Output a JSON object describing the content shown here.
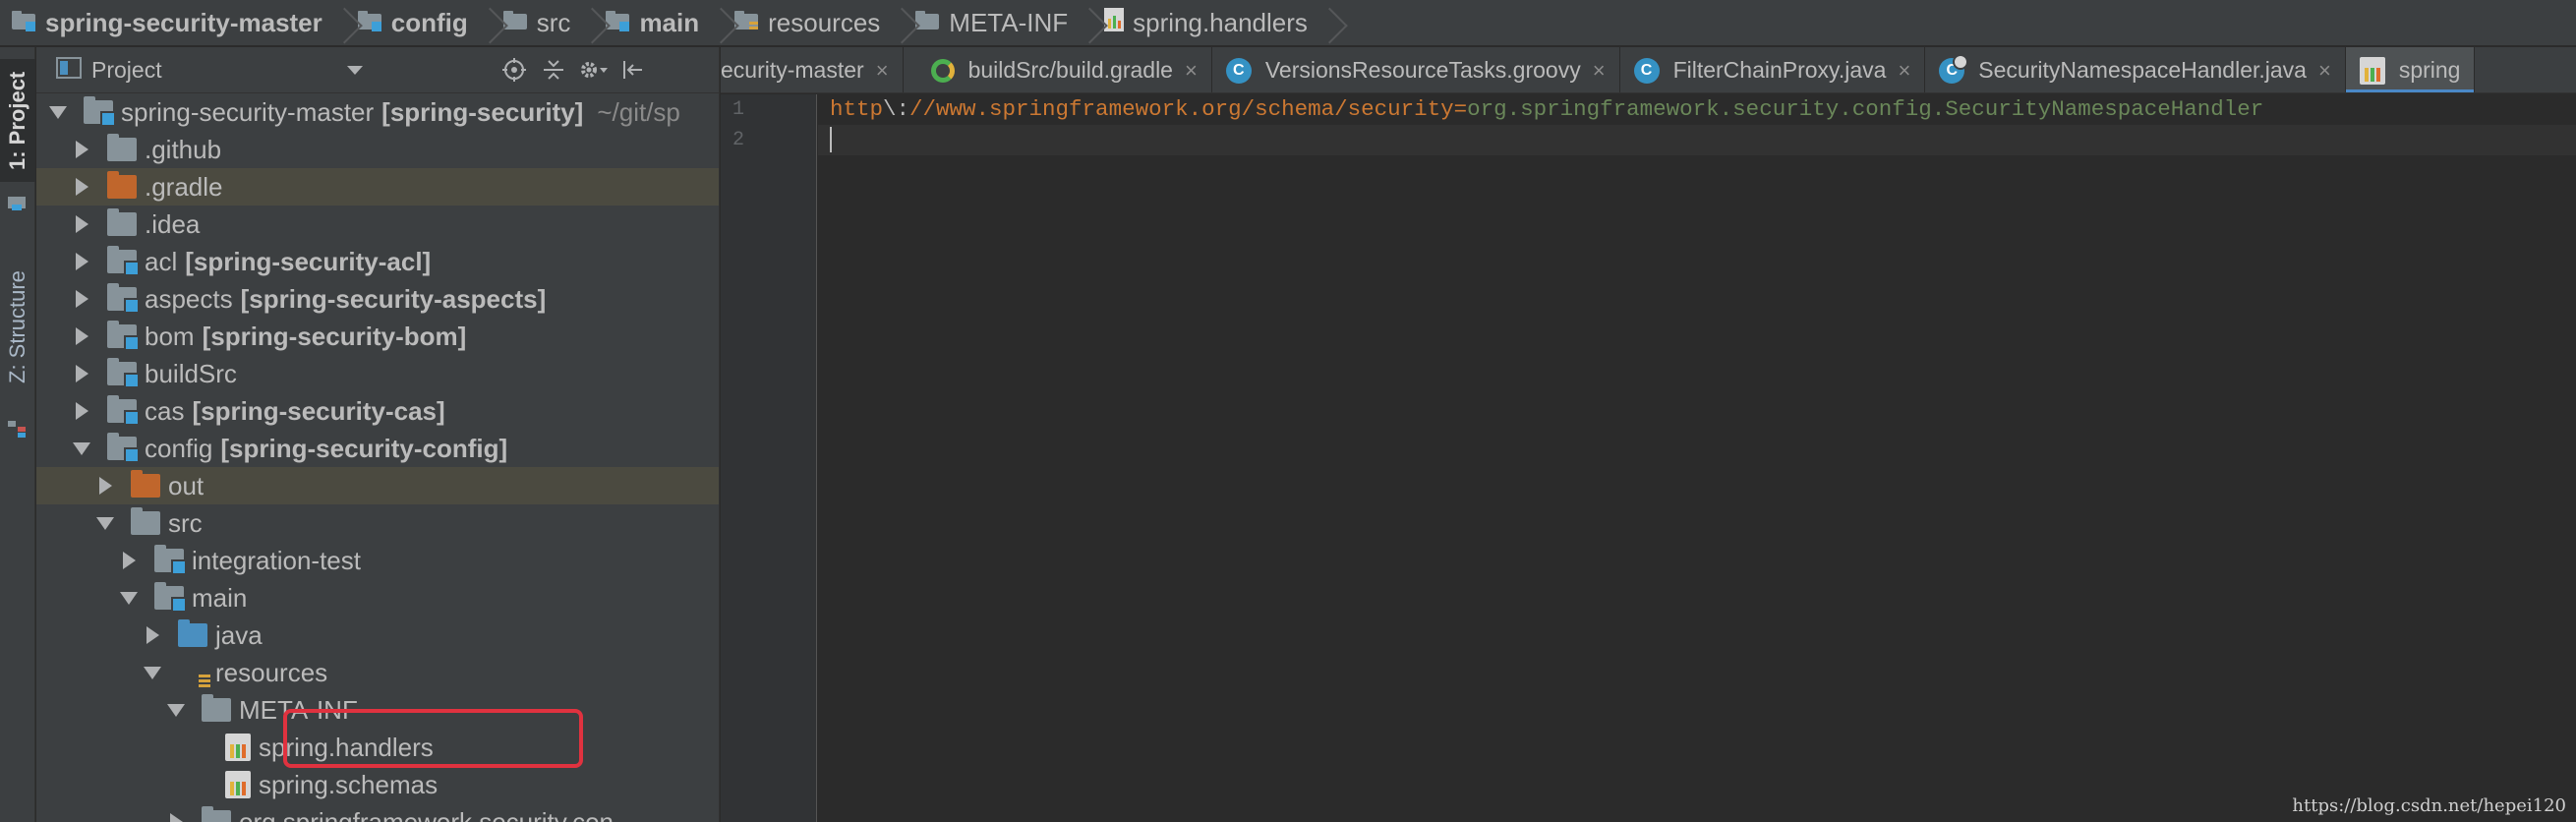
{
  "breadcrumb": [
    {
      "label": "spring-security-master",
      "icon": "folder-module-icon",
      "bold": true
    },
    {
      "label": "config",
      "icon": "folder-module-icon",
      "bold": true
    },
    {
      "label": "src",
      "icon": "folder-icon",
      "bold": false
    },
    {
      "label": "main",
      "icon": "folder-module-icon",
      "bold": true
    },
    {
      "label": "resources",
      "icon": "resources-folder-icon",
      "bold": false
    },
    {
      "label": "META-INF",
      "icon": "folder-icon",
      "bold": false
    },
    {
      "label": "spring.handlers",
      "icon": "properties-file-icon",
      "bold": false
    }
  ],
  "toolstrip": {
    "project_tab": "1: Project",
    "structure_tab": "Z: Structure"
  },
  "panel": {
    "title": "Project"
  },
  "tree": [
    {
      "indent": 0,
      "arrow": "down",
      "icon": "mod",
      "name": "spring-security-master",
      "module": "[spring-security]",
      "hint": "~/git/sp"
    },
    {
      "indent": 1,
      "arrow": "right",
      "icon": "gray",
      "name": ".github"
    },
    {
      "indent": 1,
      "arrow": "right",
      "icon": "orange",
      "name": ".gradle",
      "highlight": true
    },
    {
      "indent": 1,
      "arrow": "right",
      "icon": "gray",
      "name": ".idea"
    },
    {
      "indent": 1,
      "arrow": "right",
      "icon": "mod",
      "name": "acl",
      "module": "[spring-security-acl]"
    },
    {
      "indent": 1,
      "arrow": "right",
      "icon": "mod",
      "name": "aspects",
      "module": "[spring-security-aspects]"
    },
    {
      "indent": 1,
      "arrow": "right",
      "icon": "mod",
      "name": "bom",
      "module": "[spring-security-bom]"
    },
    {
      "indent": 1,
      "arrow": "right",
      "icon": "mod",
      "name": "buildSrc"
    },
    {
      "indent": 1,
      "arrow": "right",
      "icon": "mod",
      "name": "cas",
      "module": "[spring-security-cas]"
    },
    {
      "indent": 1,
      "arrow": "down",
      "icon": "mod",
      "name": "config",
      "module": "[spring-security-config]"
    },
    {
      "indent": 2,
      "arrow": "right",
      "icon": "orange",
      "name": "out",
      "highlight": true
    },
    {
      "indent": 2,
      "arrow": "down",
      "icon": "gray",
      "name": "src"
    },
    {
      "indent": 3,
      "arrow": "right",
      "icon": "mod",
      "name": "integration-test"
    },
    {
      "indent": 3,
      "arrow": "down",
      "icon": "mod",
      "name": "main"
    },
    {
      "indent": 4,
      "arrow": "right",
      "icon": "blue",
      "name": "java"
    },
    {
      "indent": 4,
      "arrow": "down",
      "icon": "res",
      "name": "resources"
    },
    {
      "indent": 5,
      "arrow": "down",
      "icon": "gray",
      "name": "META-INF"
    },
    {
      "indent": 6,
      "arrow": "none",
      "icon": "props",
      "name": "spring.handlers"
    },
    {
      "indent": 6,
      "arrow": "none",
      "icon": "props",
      "name": "spring.schemas"
    },
    {
      "indent": 5,
      "arrow": "right",
      "icon": "gray",
      "name": "org.springframework.security.con"
    }
  ],
  "tabs": [
    {
      "label": "ecurity-master",
      "icon": "none",
      "active": false
    },
    {
      "label": "buildSrc/build.gradle",
      "icon": "gradle",
      "active": false
    },
    {
      "label": "VersionsResourceTasks.groovy",
      "icon": "class",
      "active": false
    },
    {
      "label": "FilterChainProxy.java",
      "icon": "class",
      "active": false
    },
    {
      "label": "SecurityNamespaceHandler.java",
      "icon": "class-sub",
      "active": false
    },
    {
      "label": "spring",
      "icon": "props",
      "active": true
    }
  ],
  "tab_close_glyph": "×",
  "editor": {
    "line_numbers": [
      "1",
      "2"
    ],
    "line1": {
      "key_a": "http",
      "sep": "\\:",
      "key_b": "//www.springframework.org/schema/security",
      "eq": "=",
      "value": "org.springframework.security.config.SecurityNamespaceHandler"
    }
  },
  "watermark": "https://blog.csdn.net/hepei120",
  "colors": {
    "accent": "#4a88c7",
    "highlight_box": "#e0323f",
    "excluded_folder": "#c0662c"
  }
}
